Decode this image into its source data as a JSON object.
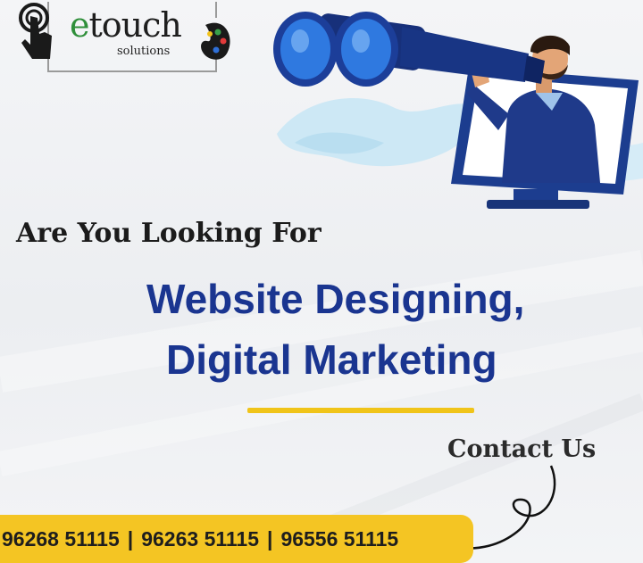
{
  "logo": {
    "brand_initial": "e",
    "brand_rest": "touch",
    "tagline": "solutions",
    "icons": [
      "touch-hand-icon",
      "palette-icon"
    ]
  },
  "hero_illustration": {
    "subject": "man-with-binoculars-from-monitor",
    "icons": [
      "binoculars-icon",
      "monitor-icon",
      "splash-icon"
    ]
  },
  "headline": "Are You Looking For",
  "services": {
    "line1": "Website Designing,",
    "line2": "Digital Marketing"
  },
  "contact_label": "Contact Us",
  "phones": {
    "numbers": [
      "96268 51115",
      "96263 51115",
      "96556 51115"
    ],
    "separator": "|"
  },
  "colors": {
    "brand_blue": "#1a3590",
    "accent_yellow": "#f4c523",
    "logo_green": "#2f8f3a",
    "background": "#eef0f3"
  }
}
